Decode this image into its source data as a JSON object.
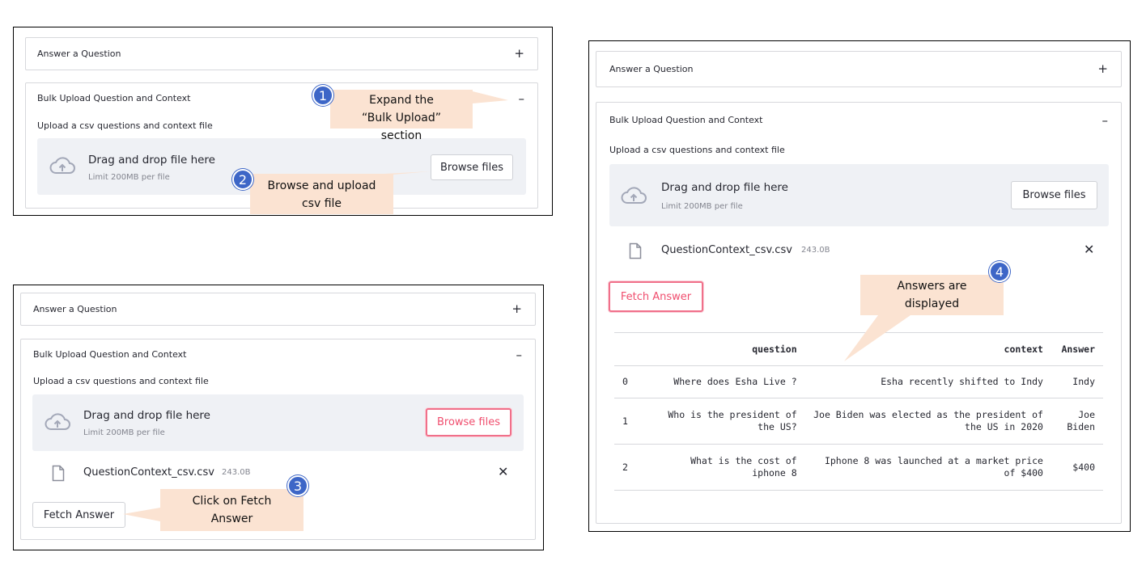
{
  "expander": {
    "answer_title": "Answer a Question",
    "bulk_title": "Bulk Upload Question and Context",
    "plus": "+",
    "minus": "–"
  },
  "uploader": {
    "label": "Upload a csv questions and context file",
    "drag_title": "Drag and drop file here",
    "limit": "Limit 200MB per file",
    "browse_label": "Browse files"
  },
  "file": {
    "name": "QuestionContext_csv.csv",
    "size": "243.0B",
    "remove": "✕"
  },
  "fetch_label": "Fetch Answer",
  "callouts": [
    {
      "num": "1",
      "text": "Expand the “Bulk Upload” section"
    },
    {
      "num": "2",
      "text": "Browse and upload csv file"
    },
    {
      "num": "3",
      "text": "Click on Fetch Answer"
    },
    {
      "num": "4",
      "text": "Answers are displayed"
    }
  ],
  "table": {
    "headers": [
      "",
      "question",
      "context",
      "Answer"
    ],
    "rows": [
      {
        "idx": "0",
        "question": "Where does Esha Live ?",
        "context": "Esha recently shifted to Indy",
        "answer": "Indy"
      },
      {
        "idx": "1",
        "question": "Who is the president of the US?",
        "context": "Joe Biden was elected as the president of the US in 2020",
        "answer": "Joe Biden"
      },
      {
        "idx": "2",
        "question": "What is the cost of iphone 8",
        "context": "Iphone 8 was launched at a market price of $400",
        "answer": "$400"
      }
    ]
  },
  "colors": {
    "accent_pink": "#f04e6e",
    "callout_bg": "#fbe3d2",
    "badge_blue": "#3d66c7",
    "dropzone_bg": "#eff1f5"
  }
}
